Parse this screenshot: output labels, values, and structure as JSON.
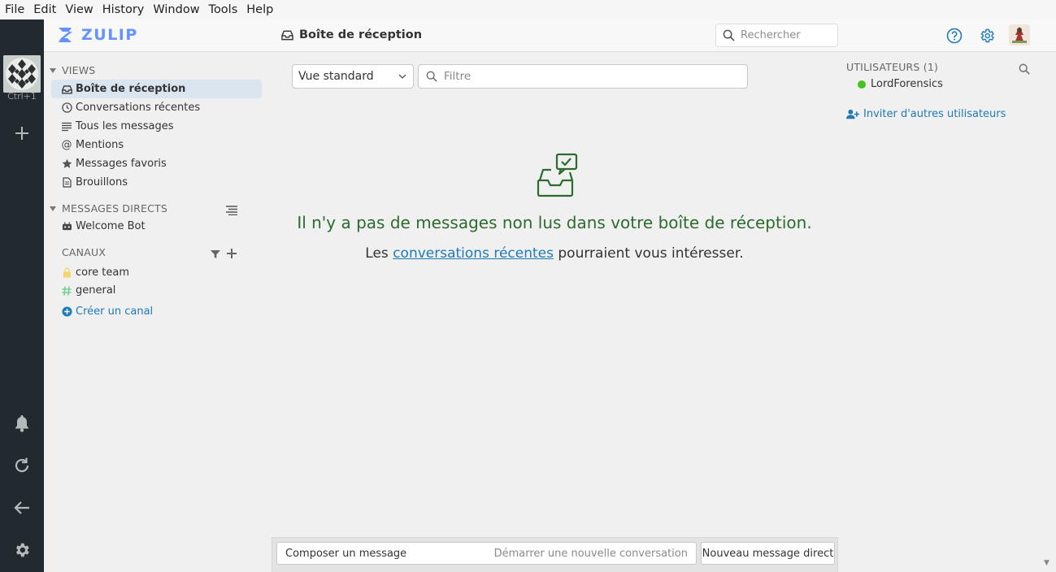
{
  "menubar": [
    "File",
    "Edit",
    "View",
    "History",
    "Window",
    "Tools",
    "Help"
  ],
  "rail": {
    "shortcut": "Ctrl+1"
  },
  "header": {
    "logo_text": "ZULIP",
    "title": "Boîte de réception",
    "search_placeholder": "Rechercher"
  },
  "left_sidebar": {
    "views_heading": "VIEWS",
    "views": [
      {
        "label": "Boîte de réception",
        "icon": "inbox-icon",
        "active": true
      },
      {
        "label": "Conversations récentes",
        "icon": "clock-icon"
      },
      {
        "label": "Tous les messages",
        "icon": "all-messages-icon"
      },
      {
        "label": "Mentions",
        "icon": "at-icon"
      },
      {
        "label": "Messages favoris",
        "icon": "star-icon"
      },
      {
        "label": "Brouillons",
        "icon": "drafts-icon"
      }
    ],
    "dm_heading": "MESSAGES DIRECTS",
    "dms": [
      {
        "label": "Welcome Bot",
        "icon": "bot-icon"
      }
    ],
    "channels_heading": "CANAUX",
    "channels": [
      {
        "label": "core team",
        "icon": "lock-icon",
        "color": "#f4d56b"
      },
      {
        "label": "general",
        "icon": "hash-icon",
        "color": "#76ce90"
      }
    ],
    "create_channel": "Créer un canal"
  },
  "main": {
    "view_select": "Vue standard",
    "filter_placeholder": "Filtre",
    "empty_title": "Il n'y a pas de messages non lus dans votre boîte de réception.",
    "empty_sub_before": "Les ",
    "empty_sub_link": "conversations récentes",
    "empty_sub_after": " pourraient vous intéresser."
  },
  "compose": {
    "compose_label": "Composer un message",
    "compose_hint": "Démarrer une nouvelle conversation",
    "dm_label": "Nouveau message direct"
  },
  "right_sidebar": {
    "users_heading": "UTILISATEURS (1)",
    "users": [
      {
        "name": "LordForensics",
        "status": "active"
      }
    ],
    "invite": "Inviter d'autres utilisateurs"
  },
  "colors": {
    "accent": "#1f7ab8",
    "empty_green": "#2c6b2f",
    "logo_blue": "#6492fe",
    "rail": "#222a30",
    "active_bg": "#dbe5f0"
  }
}
